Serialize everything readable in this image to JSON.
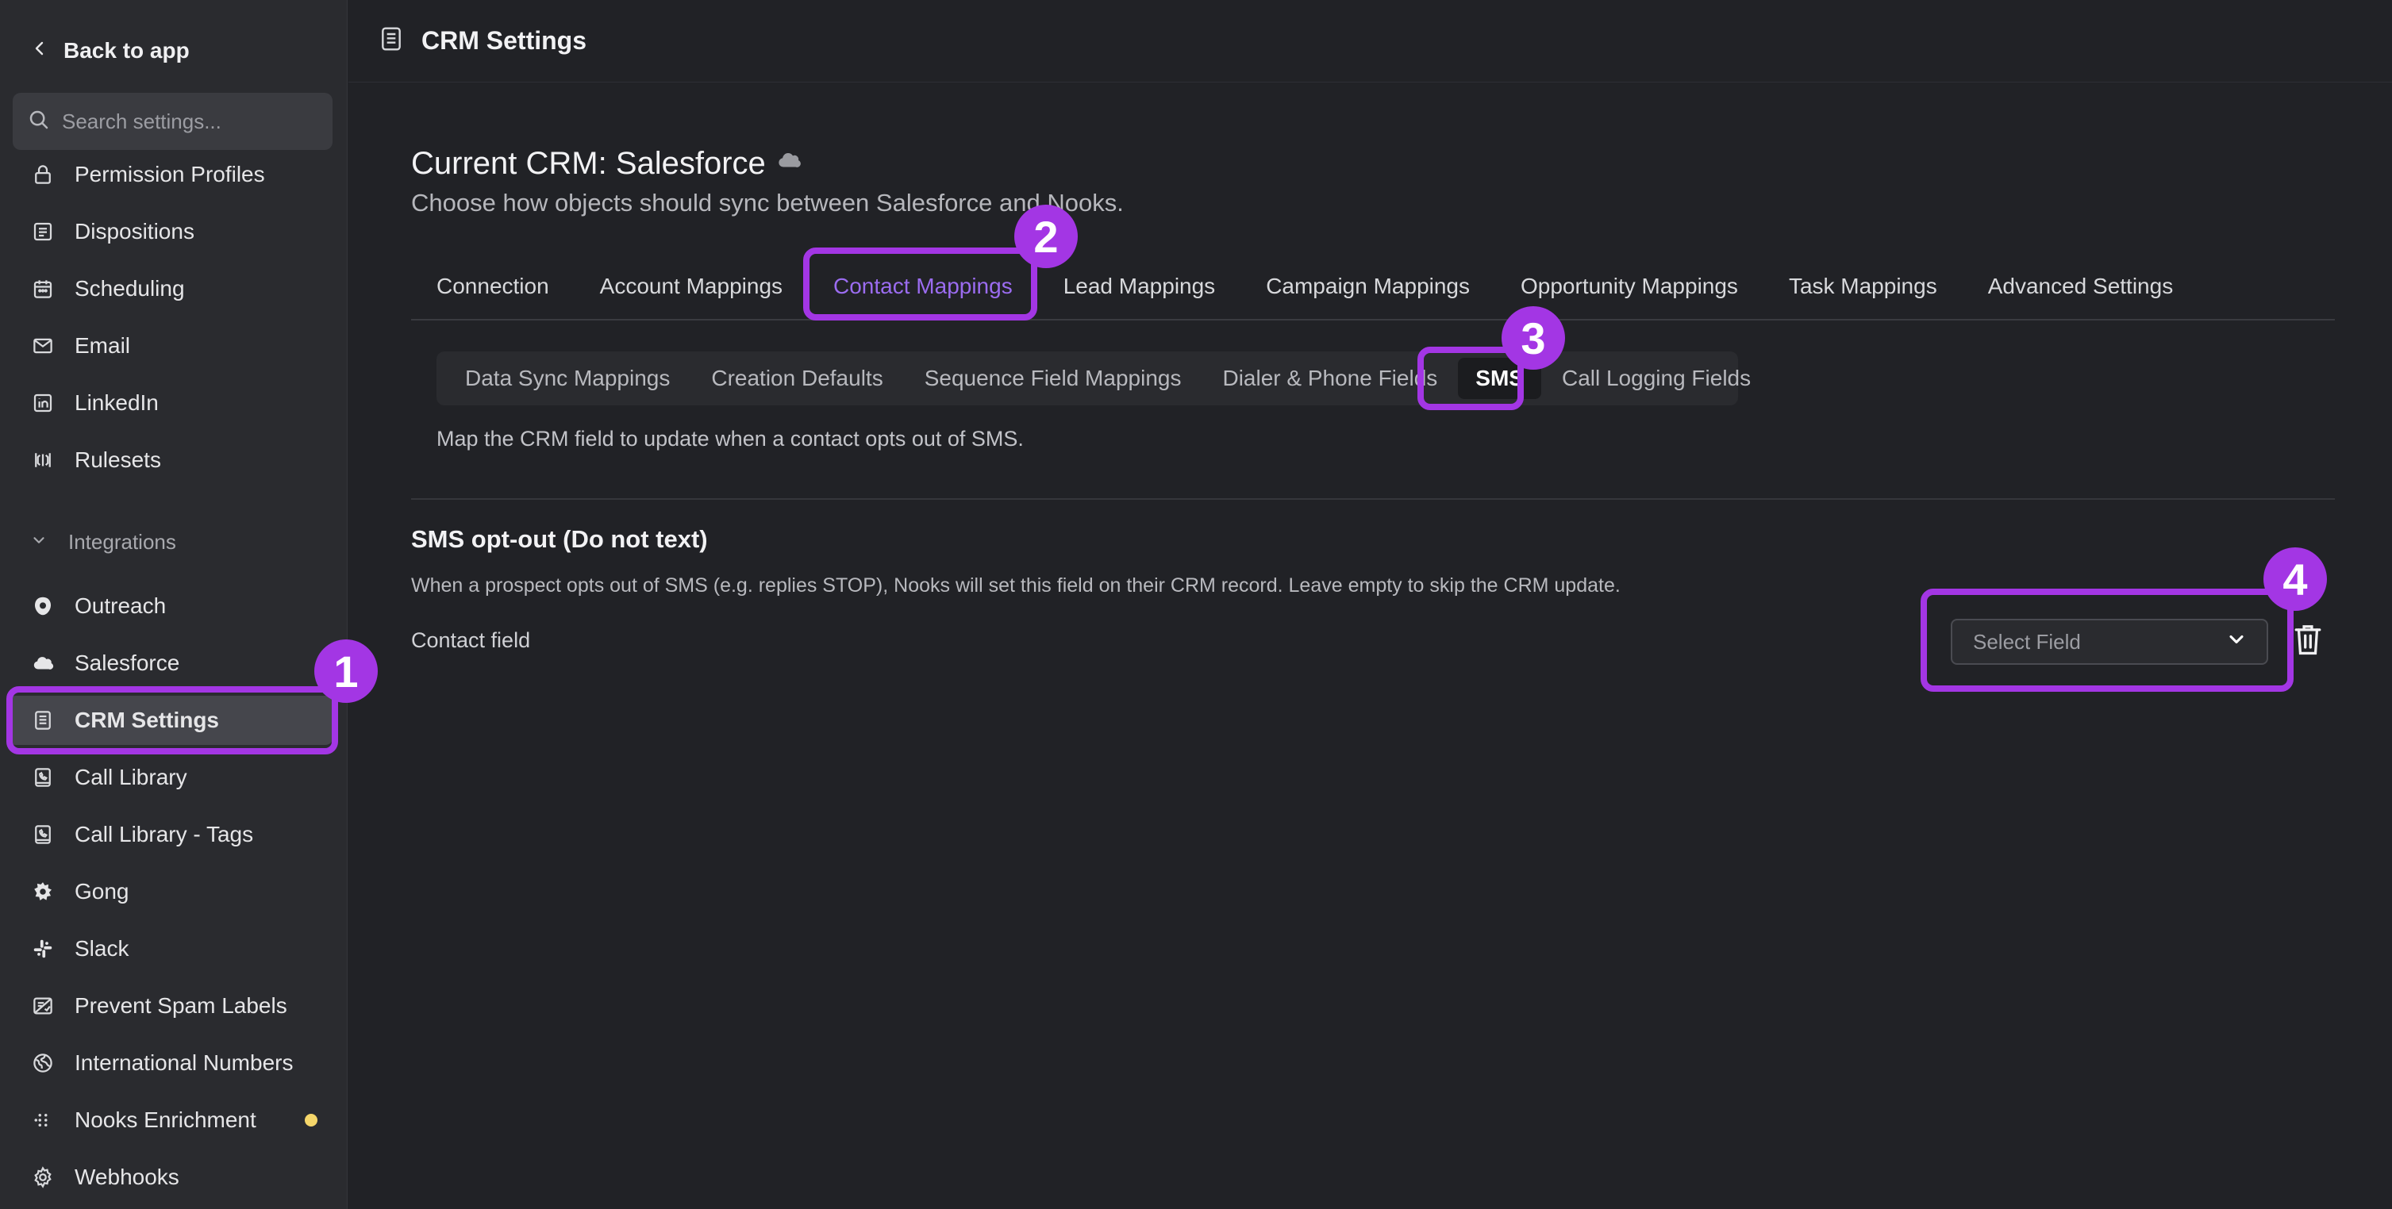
{
  "sidebar": {
    "back_label": "Back to app",
    "search_placeholder": "Search settings...",
    "items_top": [
      {
        "label": "Permission Profiles",
        "icon": "lock-icon"
      },
      {
        "label": "Dispositions",
        "icon": "list-icon"
      },
      {
        "label": "Scheduling",
        "icon": "calendar-icon"
      },
      {
        "label": "Email",
        "icon": "mail-icon"
      },
      {
        "label": "LinkedIn",
        "icon": "linkedin-icon"
      },
      {
        "label": "Rulesets",
        "icon": "rulesets-icon"
      }
    ],
    "section_label": "Integrations",
    "items_integrations": [
      {
        "label": "Outreach",
        "icon": "outreach-icon"
      },
      {
        "label": "Salesforce",
        "icon": "cloud-icon"
      },
      {
        "label": "CRM Settings",
        "icon": "document-icon",
        "active": true
      },
      {
        "label": "Call Library",
        "icon": "call-library-icon"
      },
      {
        "label": "Call Library - Tags",
        "icon": "call-library-icon"
      },
      {
        "label": "Gong",
        "icon": "gong-icon"
      },
      {
        "label": "Slack",
        "icon": "slack-icon"
      },
      {
        "label": "Prevent Spam Labels",
        "icon": "spam-label-icon"
      },
      {
        "label": "International Numbers",
        "icon": "globe-icon"
      },
      {
        "label": "Nooks Enrichment",
        "icon": "grid-dots-icon",
        "badge_color": "#f5d66a"
      },
      {
        "label": "Webhooks",
        "icon": "gear-icon"
      }
    ]
  },
  "header": {
    "title": "CRM Settings"
  },
  "main": {
    "crm_title": "Current CRM: Salesforce",
    "crm_subtitle": "Choose how objects should sync between Salesforce and Nooks.",
    "tabs": [
      "Connection",
      "Account Mappings",
      "Contact Mappings",
      "Lead Mappings",
      "Campaign Mappings",
      "Opportunity Mappings",
      "Task Mappings",
      "Advanced Settings"
    ],
    "active_tab": "Contact Mappings",
    "subtabs": [
      "Data Sync Mappings",
      "Creation Defaults",
      "Sequence Field Mappings",
      "Dialer & Phone Fields",
      "SMS",
      "Call Logging Fields"
    ],
    "active_subtab": "SMS",
    "subtab_description": "Map the CRM field to update when a contact opts out of SMS.",
    "sms_section": {
      "title": "SMS opt-out (Do not text)",
      "description": "When a prospect opts out of SMS (e.g. replies STOP), Nooks will set this field on their CRM record. Leave empty to skip the CRM update.",
      "field_label": "Contact field",
      "select_placeholder": "Select Field"
    }
  },
  "annotations": {
    "color": "#a336e4",
    "labels": [
      "1",
      "2",
      "3",
      "4"
    ]
  },
  "colors": {
    "accent": "#9b6cf0",
    "background": "#212226",
    "sidebar": "#2a2b2f"
  }
}
